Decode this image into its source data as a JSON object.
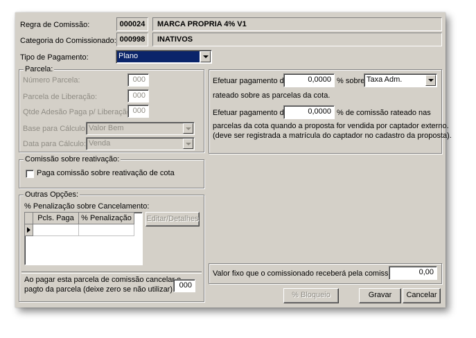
{
  "header": {
    "regra_label": "Regra de Comissão:",
    "regra_code": "000024",
    "regra_name": "MARCA PROPRIA 4% V1",
    "categoria_label": "Categoria do Comissionado:",
    "categoria_code": "000998",
    "categoria_name": "INATIVOS"
  },
  "tipo_pagamento": {
    "label": "Tipo de Pagamento:",
    "value": "Plano"
  },
  "parcela": {
    "title": "Parcela:",
    "numero_label": "Número Parcela:",
    "numero_value": "000",
    "liberacao_label": "Parcela de Liberação:",
    "liberacao_value": "000",
    "qtde_label": "Qtde Adesão Paga p/ Liberação:",
    "qtde_value": "000",
    "base_label": "Base para Cálculo:",
    "base_value": "Valor Bem",
    "data_label": "Data para Cálculo:",
    "data_value": "Venda"
  },
  "reativacao": {
    "title": "Comissão sobre reativação:",
    "checkbox_label": "Paga comissão sobre reativação de cota"
  },
  "outras": {
    "title": "Outras Opções:",
    "penalizacao_label": "% Penalização sobre Cancelamento:",
    "columns": [
      "Pcls. Paga",
      "% Penalização"
    ],
    "editar_button": "Editar/Detalhes",
    "cancel_text_line1": "Ao pagar esta parcela de comissão cancelar o",
    "cancel_text_line2": "pagto da parcela (deixe zero se não utilizar):",
    "cancel_value": "000"
  },
  "pagamento": {
    "efetuar1_label": "Efetuar pagamento de",
    "efetuar1_value": "0,0000",
    "sobre_label": "% sobre",
    "sobre_value": "Taxa Adm.",
    "rateado_text": "rateado sobre as parcelas da cota.",
    "efetuar2_label": "Efetuar pagamento de",
    "efetuar2_value": "0,0000",
    "comissao_text": "% de comissão rateado nas",
    "captador_line1": "parcelas da cota quando a proposta for vendida por captador externo.",
    "captador_line2": "(deve ser registrada a matrícula do captador no cadastro da proposta)."
  },
  "valor_fixo": {
    "label": "Valor fixo que o comissionado receberá pela comissão:",
    "value": "0,00"
  },
  "buttons": {
    "bloqueio": "% Bloqueio",
    "gravar": "Gravar",
    "cancelar": "Cancelar"
  }
}
